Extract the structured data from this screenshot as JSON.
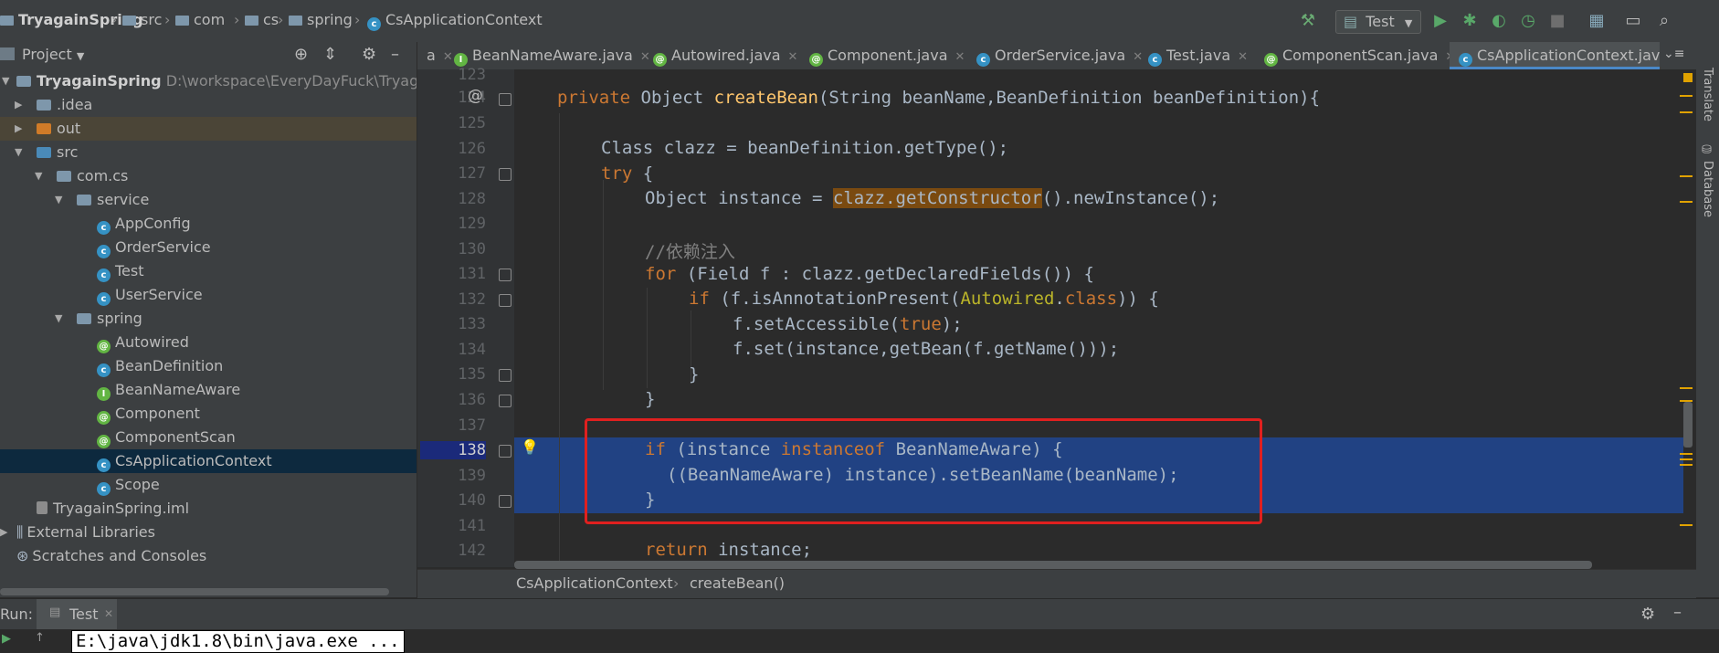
{
  "nav": {
    "project": "TryagainSpring",
    "crumbs": [
      "src",
      "com",
      "cs",
      "spring",
      "CsApplicationContext"
    ],
    "run_config": "Test"
  },
  "project_panel": {
    "title": "Project",
    "root": "TryagainSpring",
    "root_path": "D:\\workspace\\EveryDayFuck\\TryagainSpr",
    "items": [
      {
        "label": ".idea"
      },
      {
        "label": "out"
      },
      {
        "label": "src"
      },
      {
        "label": "com.cs"
      },
      {
        "label": "service"
      },
      {
        "label": "AppConfig"
      },
      {
        "label": "OrderService"
      },
      {
        "label": "Test"
      },
      {
        "label": "UserService"
      },
      {
        "label": "spring"
      },
      {
        "label": "Autowired"
      },
      {
        "label": "BeanDefinition"
      },
      {
        "label": "BeanNameAware"
      },
      {
        "label": "Component"
      },
      {
        "label": "ComponentScan"
      },
      {
        "label": "CsApplicationContext"
      },
      {
        "label": "Scope"
      },
      {
        "label": "TryagainSpring.iml"
      },
      {
        "label": "External Libraries"
      },
      {
        "label": "Scratches and Consoles"
      }
    ]
  },
  "tabs": [
    {
      "label": "a"
    },
    {
      "label": "BeanNameAware.java"
    },
    {
      "label": "Autowired.java"
    },
    {
      "label": "Component.java"
    },
    {
      "label": "OrderService.java"
    },
    {
      "label": "Test.java"
    },
    {
      "label": "ComponentScan.java"
    },
    {
      "label": "CsApplicationContext.java"
    }
  ],
  "editor": {
    "line_numbers": [
      "123",
      "124",
      "125",
      "126",
      "127",
      "128",
      "129",
      "130",
      "131",
      "132",
      "133",
      "134",
      "135",
      "136",
      "137",
      "138",
      "139",
      "140",
      "141",
      "142"
    ],
    "code": {
      "l124_private": "private",
      "l124_obj": " Object ",
      "l124_fn": "createBean",
      "l124_rest": "(String beanName,BeanDefinition beanDefinition){",
      "l126": "Class clazz = beanDefinition.getType();",
      "l127_try": "try",
      "l127_rest": " {",
      "l128_a": "Object instance = ",
      "l128_b": "clazz.getConstructor",
      "l128_c": "().newInstance();",
      "l130": "//依赖注入",
      "l131_for": "for",
      "l131_rest": " (Field f : clazz.getDeclaredFields()) {",
      "l132_if": "if",
      "l132_a": " (f.isAnnotationPresent(",
      "l132_ann": "Autowired",
      "l132_dot": ".",
      "l132_class": "class",
      "l132_end": ")) {",
      "l133_a": "f.setAccessible(",
      "l133_true": "true",
      "l133_b": ");",
      "l134": "f.set(instance,getBean(f.getName()));",
      "l135": "}",
      "l136": "}",
      "l138_if": "if",
      "l138_a": " (instance ",
      "l138_inst": "instanceof",
      "l138_b": " BeanNameAware) {",
      "l139": "((BeanNameAware) instance).setBeanName(beanName);",
      "l140": "}",
      "l142_ret": "return",
      "l142_rest": " instance;"
    }
  },
  "bottom_breadcrumb": [
    "CsApplicationContext",
    "createBean()"
  ],
  "right_bar": [
    "Translate",
    "Database"
  ],
  "run_panel": {
    "label": "Run:",
    "tab": "Test",
    "console_line": "E:\\java\\jdk1.8\\bin\\java.exe ..."
  },
  "colors": {
    "selection": "#214283",
    "highlight_box": "#e0201f",
    "keyword": "#cc7832",
    "method": "#ffc66d"
  }
}
